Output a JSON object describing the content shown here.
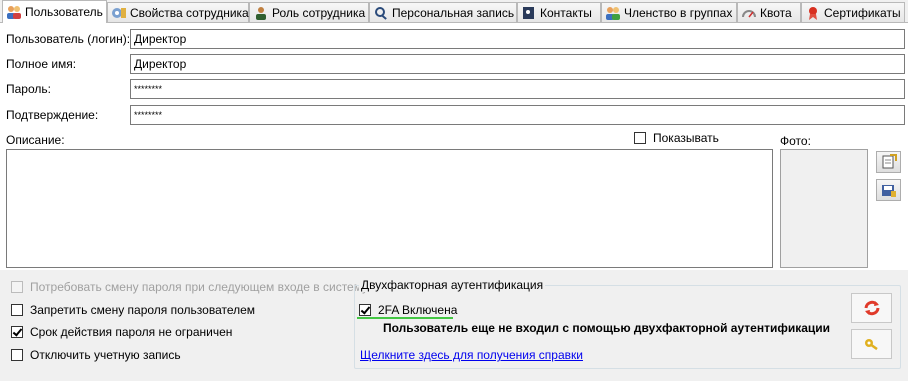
{
  "tabs": [
    {
      "label": "Пользователь",
      "icon": "users-icon",
      "active": true
    },
    {
      "label": "Свойства сотрудника",
      "icon": "gear-icon"
    },
    {
      "label": "Роль сотрудника",
      "icon": "role-icon"
    },
    {
      "label": "Персональная запись",
      "icon": "person-search-icon"
    },
    {
      "label": "Контакты",
      "icon": "contacts-icon"
    },
    {
      "label": "Членство в группах",
      "icon": "group-icon"
    },
    {
      "label": "Квота",
      "icon": "gauge-icon"
    },
    {
      "label": "Сертификаты",
      "icon": "certificate-icon"
    }
  ],
  "form": {
    "login_label": "Пользователь (логин):",
    "login_value": "Директор",
    "fullname_label": "Полное имя:",
    "fullname_value": "Директор",
    "password_label": "Пароль:",
    "password_value": "********",
    "confirm_label": "Подтверждение:",
    "confirm_value": "********",
    "description_label": "Описание:",
    "show_label": "Показывать",
    "photo_label": "Фото:"
  },
  "options": {
    "require_change": "Потребовать смену пароля при следующем входе в систему",
    "forbid_change": "Запретить смену пароля пользователем",
    "no_expiry": "Срок действия пароля не ограничен",
    "disable_account": "Отключить учетную запись"
  },
  "twofa": {
    "group_title": "Двухфакторная аутентификация",
    "enabled_label": "2FA Включена",
    "status_text": "Пользователь еще не входил с помощью двухфакторной аутентификации",
    "help_link": "Щелкните здесь для получения справки"
  },
  "colors": {
    "link": "#0000ee",
    "underline_accent": "#44c744",
    "refresh_icon": "#e03a2a",
    "key_icon": "#e0b020"
  }
}
